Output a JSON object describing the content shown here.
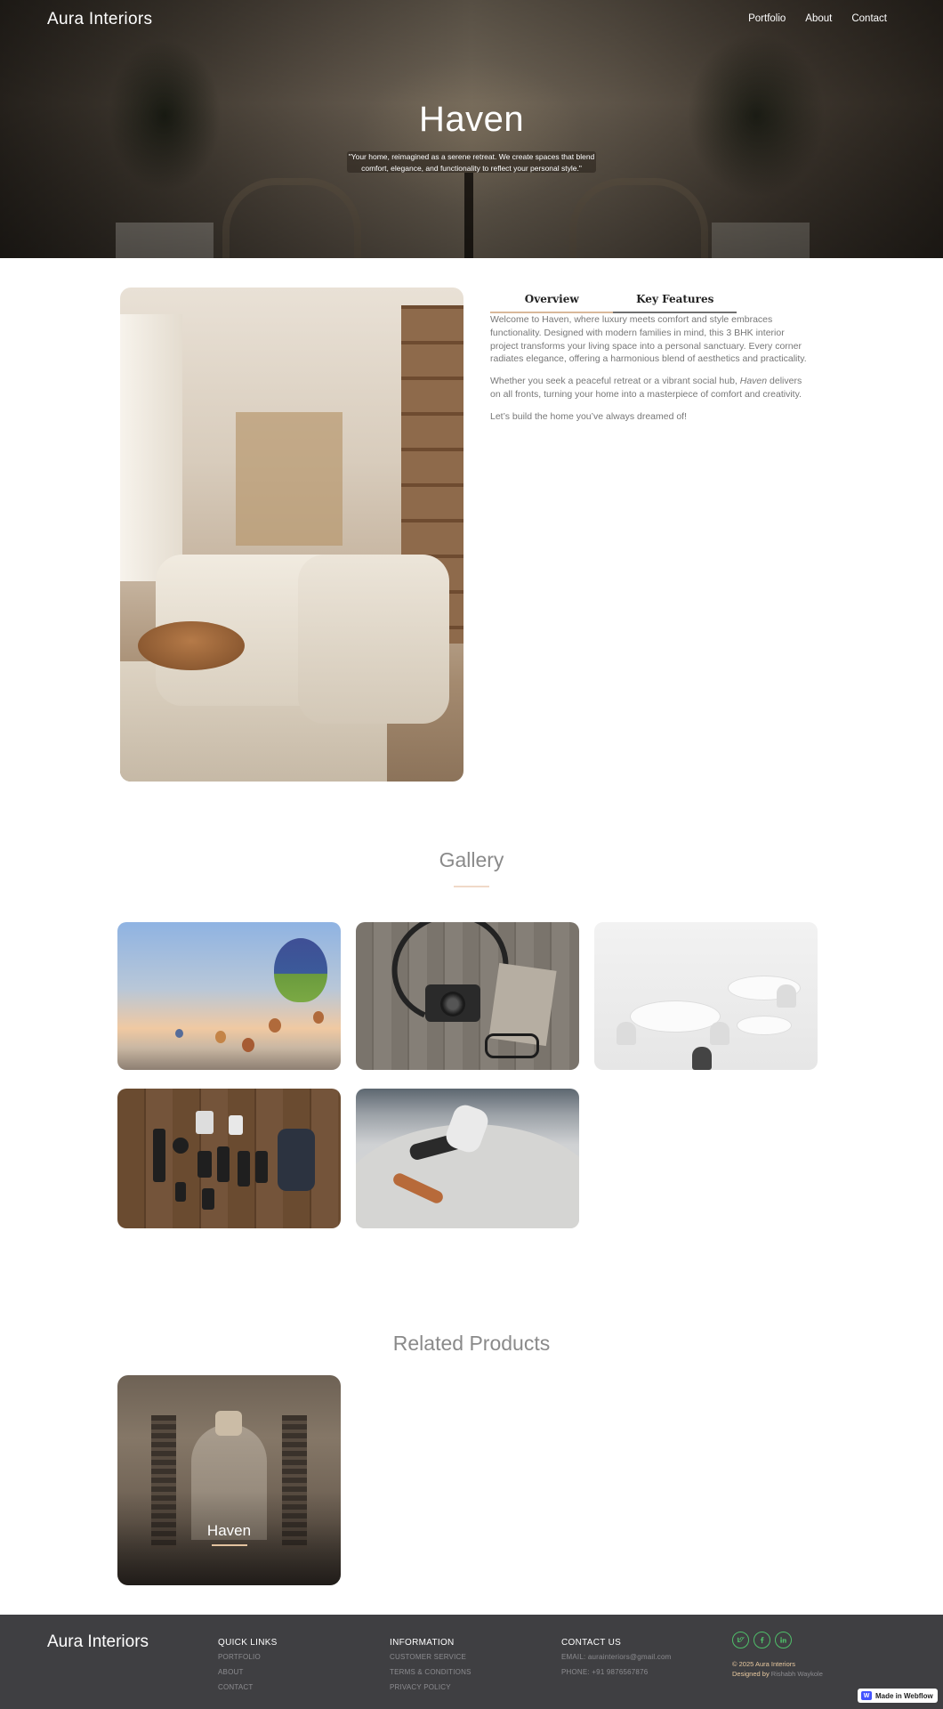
{
  "header": {
    "brand": "Aura Interiors",
    "nav": [
      "Portfolio",
      "About",
      "Contact"
    ]
  },
  "hero": {
    "title": "Haven",
    "subtitle": "\"Your home, reimagined as a serene retreat. We create spaces that blend comfort, elegance, and functionality to reflect your personal style.\""
  },
  "tabs": [
    "Overview",
    "Key Features"
  ],
  "overview": {
    "p1": "Welcome to Haven, where luxury meets comfort and style embraces functionality. Designed with modern families in mind, this 3 BHK interior project transforms your living space into a personal sanctuary. Every corner radiates elegance, offering a harmonious blend of aesthetics and practicality.",
    "p2_before": "Whether you seek a peaceful retreat or a vibrant social hub, ",
    "p2_em": "Haven",
    "p2_after": " delivers on all fronts, turning your home into a masterpiece of comfort and creativity.",
    "p3": "Let’s build the home you’ve always dreamed of!"
  },
  "gallery": {
    "title": "Gallery",
    "images": [
      "hot-air-balloons",
      "camera-on-wood",
      "cafe-tables",
      "gear-flatlay",
      "skateboarder"
    ]
  },
  "related": {
    "title": "Related Products",
    "items": [
      {
        "name": "Haven"
      }
    ]
  },
  "footer": {
    "brand": "Aura Interiors",
    "quick_links": {
      "heading": "QUICK LINKS",
      "items": [
        "PORTFOLIO",
        "ABOUT",
        "CONTACT"
      ]
    },
    "information": {
      "heading": "INFORMATION",
      "items": [
        "CUSTOMER SERVICE",
        "TERMS & CONDITIONS",
        "PRIVACY POLICY"
      ]
    },
    "contact": {
      "heading": "CONTACT US",
      "email": "EMAIL: aurainteriors@gmail.com",
      "phone": "PHONE: +91 9876567876"
    },
    "social_icons": [
      "twitter-icon",
      "facebook-icon",
      "linkedin-icon"
    ],
    "copyright": "© 2025 Aura Interiors",
    "designed_label": "Designed by",
    "designer": "Rishabh Waykole"
  },
  "badge": {
    "text": "Made in Webflow"
  },
  "colors": {
    "accent": "#e3c29f",
    "footer_bg": "#3f3f42",
    "social": "#4fbf6a"
  }
}
